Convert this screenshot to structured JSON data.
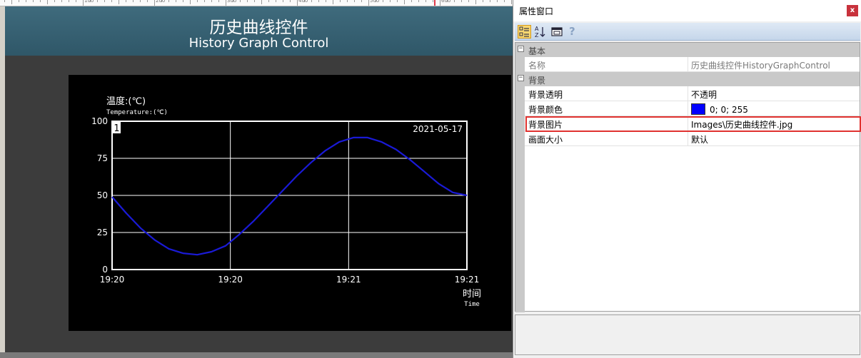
{
  "designer": {
    "ruler": {
      "labels": [
        "100",
        "200",
        "300",
        "400",
        "500",
        "600",
        "700"
      ]
    },
    "banner": {
      "title_zh": "历史曲线控件",
      "title_en": "History Graph Control"
    },
    "chart_data": {
      "type": "line",
      "title": "",
      "date_label": "2021-05-17",
      "panel_label": "1",
      "ylabel": "温度:(℃)",
      "ylabel_sub": "Temperature:(℃)",
      "xlabel": "时间",
      "xlabel_sub": "Time",
      "ylim": [
        0,
        100
      ],
      "yticks": [
        "0",
        "25",
        "50",
        "75",
        "100"
      ],
      "xticks": [
        "19:20",
        "19:20",
        "19:21",
        "19:21"
      ],
      "grid": true,
      "line_color": "#1a1ad6",
      "series": [
        {
          "x": [
            0,
            0.04,
            0.08,
            0.12,
            0.16,
            0.2,
            0.24,
            0.28,
            0.32,
            0.36,
            0.4,
            0.44,
            0.48,
            0.52,
            0.56,
            0.6,
            0.64,
            0.68,
            0.72,
            0.76,
            0.8,
            0.84,
            0.88,
            0.92,
            0.96,
            1.0
          ],
          "values": [
            49,
            38,
            28,
            20,
            14,
            11,
            10,
            12,
            16,
            24,
            33,
            43,
            53,
            63,
            72,
            80,
            86,
            89,
            89,
            86,
            81,
            74,
            66,
            58,
            52,
            50
          ]
        }
      ]
    }
  },
  "properties": {
    "title": "属性窗口",
    "close_label": "x",
    "toolbar": {
      "icons": [
        "categorized-icon",
        "alphabetical-icon",
        "property-pages-icon",
        "help-icon"
      ],
      "help_glyph": "?"
    },
    "categories": [
      {
        "sign": "−",
        "name": "基本"
      },
      {
        "sign": "−",
        "name": "背景"
      }
    ],
    "rows": [
      {
        "key": "名称",
        "value": "历史曲线控件HistoryGraphControl"
      },
      {
        "key": "背景透明",
        "value": "不透明"
      },
      {
        "key": "背景颜色",
        "value": "0; 0; 255",
        "color": "#0000ff"
      },
      {
        "key": "背景图片",
        "value": "Images\\历史曲线控件.jpg"
      },
      {
        "key": "画面大小",
        "value": "默认"
      }
    ],
    "highlight_color": "#e0322f"
  }
}
